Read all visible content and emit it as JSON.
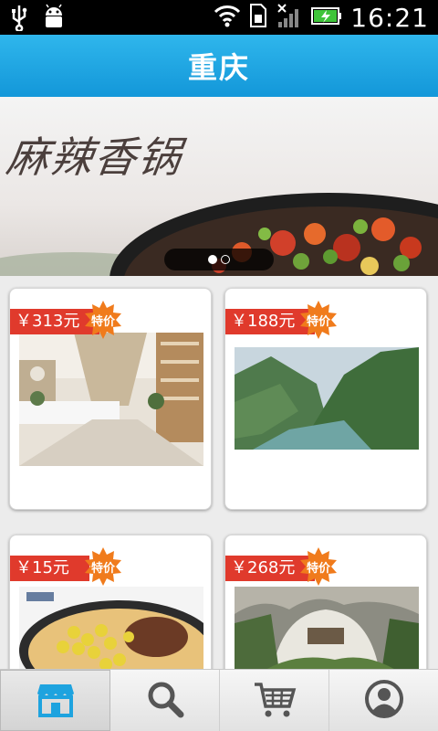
{
  "statusbar": {
    "time": "16:21",
    "icons": [
      "usb-icon",
      "android-debug-icon",
      "wifi-icon",
      "sim-icon",
      "signal-icon",
      "battery-charging-icon"
    ]
  },
  "header": {
    "title": "重庆"
  },
  "banner": {
    "text": "麻辣香锅",
    "pager": {
      "count": 2,
      "active": 0
    }
  },
  "products": [
    {
      "price": "￥313元",
      "badge": "特价",
      "image": "hotel-lobby"
    },
    {
      "price": "￥188元",
      "badge": "特价",
      "image": "river-gorge"
    },
    {
      "price": "￥15元",
      "badge": "特价",
      "image": "noodles-dish"
    },
    {
      "price": "￥268元",
      "badge": "特价",
      "image": "cave-landscape"
    }
  ],
  "nav": {
    "items": [
      {
        "icon": "store-icon",
        "active": true
      },
      {
        "icon": "search-icon",
        "active": false
      },
      {
        "icon": "cart-icon",
        "active": false
      },
      {
        "icon": "profile-icon",
        "active": false
      }
    ]
  },
  "colors": {
    "accent": "#1ea3df",
    "price_tag": "#e03a2c",
    "badge": "#f07b1c"
  }
}
